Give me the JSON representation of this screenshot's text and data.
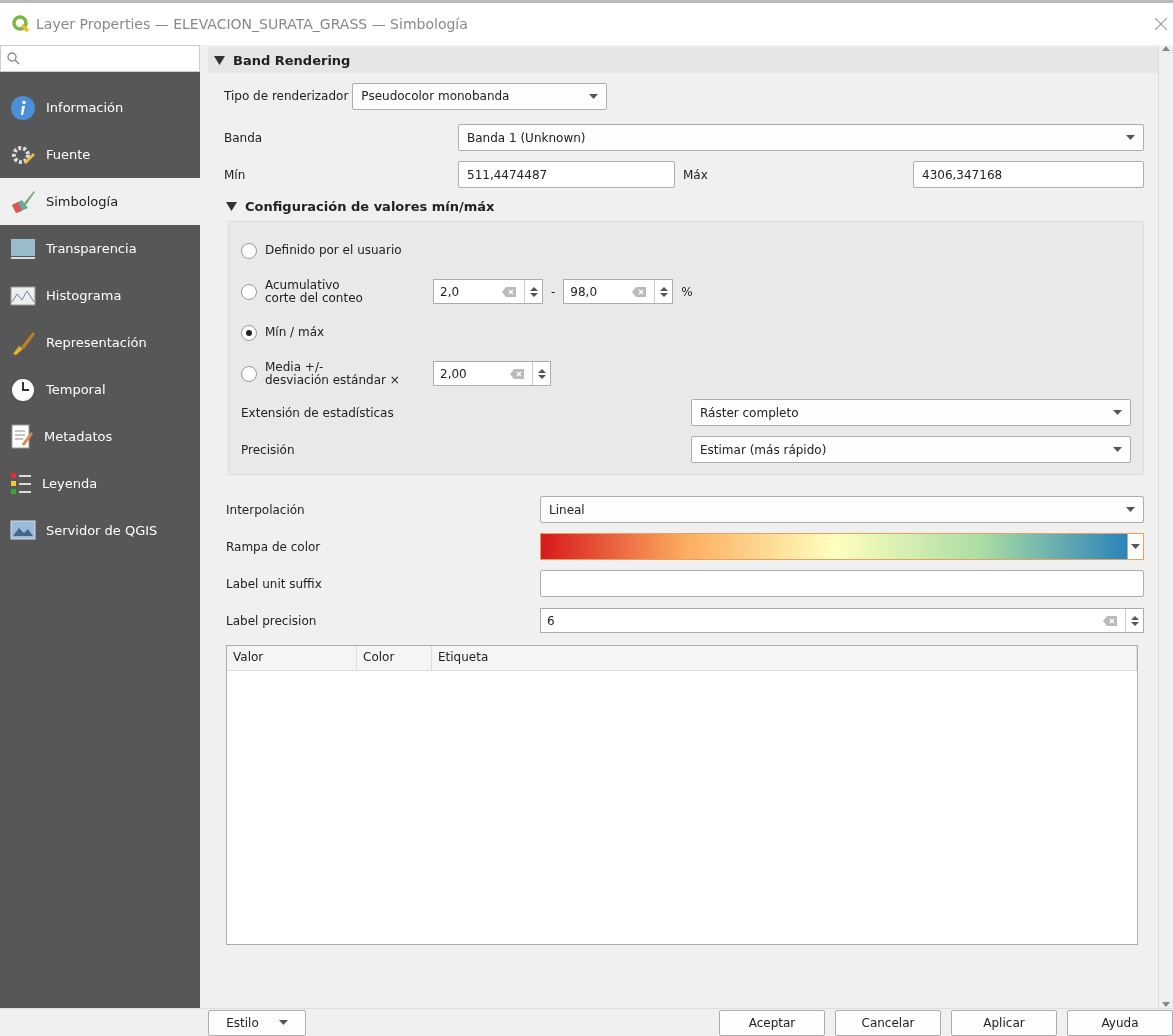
{
  "window": {
    "title": "Layer Properties — ELEVACION_SURATA_GRASS — Simbología"
  },
  "sidebar": {
    "items": [
      {
        "label": "Información",
        "selected": false
      },
      {
        "label": "Fuente",
        "selected": false
      },
      {
        "label": "Simbología",
        "selected": true
      },
      {
        "label": "Transparencia",
        "selected": false
      },
      {
        "label": "Histograma",
        "selected": false
      },
      {
        "label": "Representación",
        "selected": false
      },
      {
        "label": "Temporal",
        "selected": false
      },
      {
        "label": "Metadatos",
        "selected": false
      },
      {
        "label": "Leyenda",
        "selected": false
      },
      {
        "label": "Servidor de QGIS",
        "selected": false
      }
    ]
  },
  "band_rendering": {
    "title": "Band Rendering",
    "expanded": true,
    "renderer_type": {
      "label": "Tipo de renderizador",
      "value": "Pseudocolor monobanda"
    },
    "band": {
      "label": "Banda",
      "value": "Banda 1 (Unknown)"
    },
    "min": {
      "label": "Mín",
      "value": "511,4474487"
    },
    "max": {
      "label": "Máx",
      "value": "4306,347168"
    }
  },
  "minmax_settings": {
    "title": "Configuración de valores mín/máx",
    "expanded": true,
    "options": [
      {
        "kind": "plain",
        "lines": [
          "Definido por el usuario"
        ],
        "selected": false
      },
      {
        "kind": "range",
        "lines": [
          "Acumulativo",
          "corte del conteo"
        ],
        "selected": false,
        "from": "2,0",
        "separator": "-",
        "to": "98,0",
        "unit": "%"
      },
      {
        "kind": "plain",
        "lines": [
          "Mín / máx"
        ],
        "selected": true
      },
      {
        "kind": "single",
        "lines": [
          "Media +/-",
          "desviación estándar ×"
        ],
        "selected": false,
        "value": "2,00"
      }
    ],
    "statistics_extent": {
      "label": "Extensión de estadísticas",
      "value": "Ráster completo"
    },
    "accuracy": {
      "label": "Precisión",
      "value": "Estimar (más rápido)"
    }
  },
  "interpolation": {
    "label": "Interpolación",
    "value": "Lineal"
  },
  "color_ramp": {
    "label": "Rampa de color"
  },
  "label_unit_suffix": {
    "label": "Label unit suffix"
  },
  "label_precision": {
    "label": "Label precision",
    "value": "6"
  },
  "table": {
    "columns": [
      "Valor",
      "Color",
      "Etiqueta"
    ]
  },
  "footer": {
    "style_button": "Estilo",
    "buttons": [
      "Aceptar",
      "Cancelar",
      "Aplicar",
      "Ayuda"
    ]
  }
}
